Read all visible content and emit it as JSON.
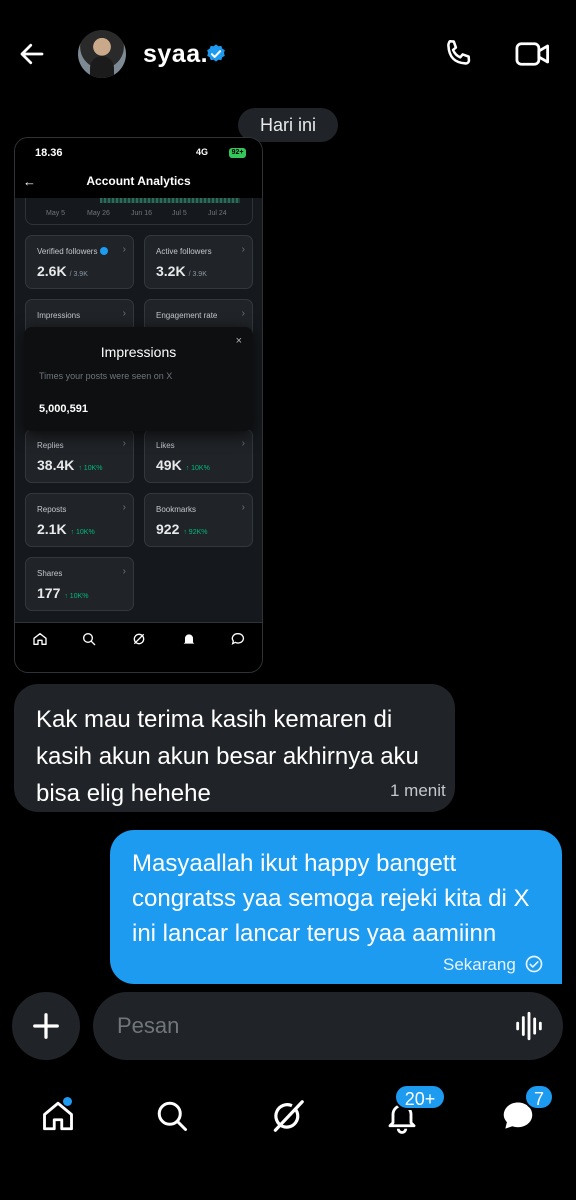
{
  "header": {
    "contact_name": "syaa.",
    "back_icon": "arrow-left-icon",
    "call_icon": "phone-icon",
    "video_icon": "video-camera-icon"
  },
  "date_separator": "Hari ini",
  "shared_image": {
    "status_time": "18.36",
    "status_network": "4G",
    "status_battery": "92+",
    "screen_title": "Account Analytics",
    "chart_axis": [
      "May 5",
      "May 26",
      "Jun 16",
      "Jul 5",
      "Jul 24"
    ],
    "cards": [
      {
        "label": "Verified followers",
        "value": "2.6K",
        "sub": "/ 3.9K",
        "trend": "",
        "verified": true
      },
      {
        "label": "Active followers",
        "value": "3.2K",
        "sub": "/ 3.9K",
        "trend": ""
      },
      {
        "label": "Impressions",
        "value": "",
        "sub": "",
        "trend": ""
      },
      {
        "label": "Engagement rate",
        "value": "",
        "sub": "",
        "trend": ""
      },
      {
        "label": "Replies",
        "value": "38.4K",
        "sub": "",
        "trend": "↑ 10K%"
      },
      {
        "label": "Likes",
        "value": "49K",
        "sub": "",
        "trend": "↑ 10K%"
      },
      {
        "label": "Reposts",
        "value": "2.1K",
        "sub": "",
        "trend": "↑ 10K%"
      },
      {
        "label": "Bookmarks",
        "value": "922",
        "sub": "",
        "trend": "↑ 92K%"
      },
      {
        "label": "Shares",
        "value": "177",
        "sub": "",
        "trend": "↑ 10K%"
      }
    ],
    "popup": {
      "title": "Impressions",
      "description": "Times your posts were seen on X",
      "value": "5,000,591",
      "close": "×"
    }
  },
  "messages": [
    {
      "direction": "incoming",
      "text": "Kak mau terima kasih kemaren di kasih akun akun besar akhirnya aku bisa elig hehehe",
      "time": "1 menit"
    },
    {
      "direction": "outgoing",
      "text": "Masyaallah ikut happy bangett congratss yaa semoga rejeki kita di X ini lancar lancar terus yaa aamiinn",
      "time": "Sekarang"
    }
  ],
  "composer": {
    "placeholder": "Pesan",
    "add_icon": "plus-icon",
    "voice_icon": "voice-waveform-icon"
  },
  "bottom_nav": {
    "items": [
      "home",
      "search",
      "grok",
      "notifications",
      "messages"
    ],
    "notifications_badge": "20+",
    "messages_badge": "7"
  },
  "colors": {
    "accent": "#1d9bf0",
    "bubble_incoming": "#202327",
    "background": "#000000",
    "trend_green": "#00ba7c"
  }
}
